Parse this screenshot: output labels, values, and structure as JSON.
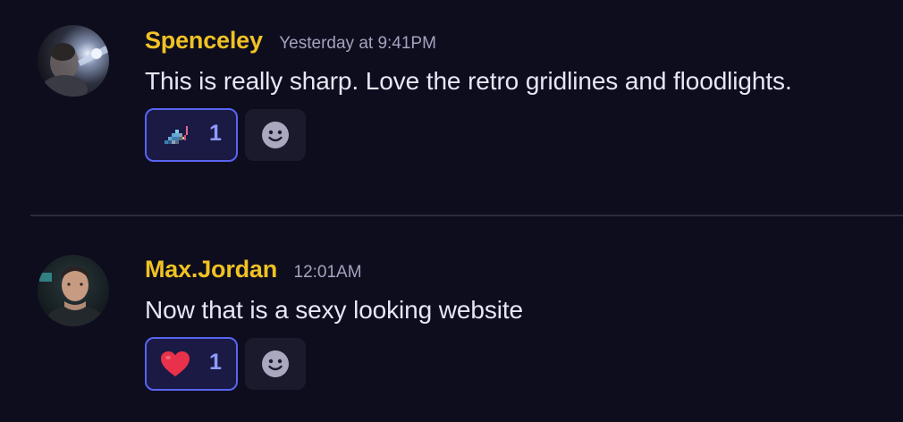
{
  "messages": [
    {
      "username": "Spenceley",
      "timestamp": "Yesterday at 9:41PM",
      "text": "This is really sharp. Love the retro gridlines and floodlights.",
      "reaction": {
        "emoji": "pixel-art-bird-emoji",
        "count": "1"
      },
      "username_color": "#f0c224"
    },
    {
      "username": "Max.Jordan",
      "timestamp": "12:01AM",
      "text": "Now that is a sexy looking website",
      "reaction": {
        "emoji": "red-heart-emoji",
        "count": "1"
      },
      "username_color": "#f0c224"
    }
  ],
  "colors": {
    "background": "#0e0d1e",
    "reaction_border": "#5865f2",
    "reaction_count": "#8f9bff",
    "text": "#e7e6f4",
    "timestamp": "#a4a2bd",
    "divider": "#2c2b3d"
  }
}
